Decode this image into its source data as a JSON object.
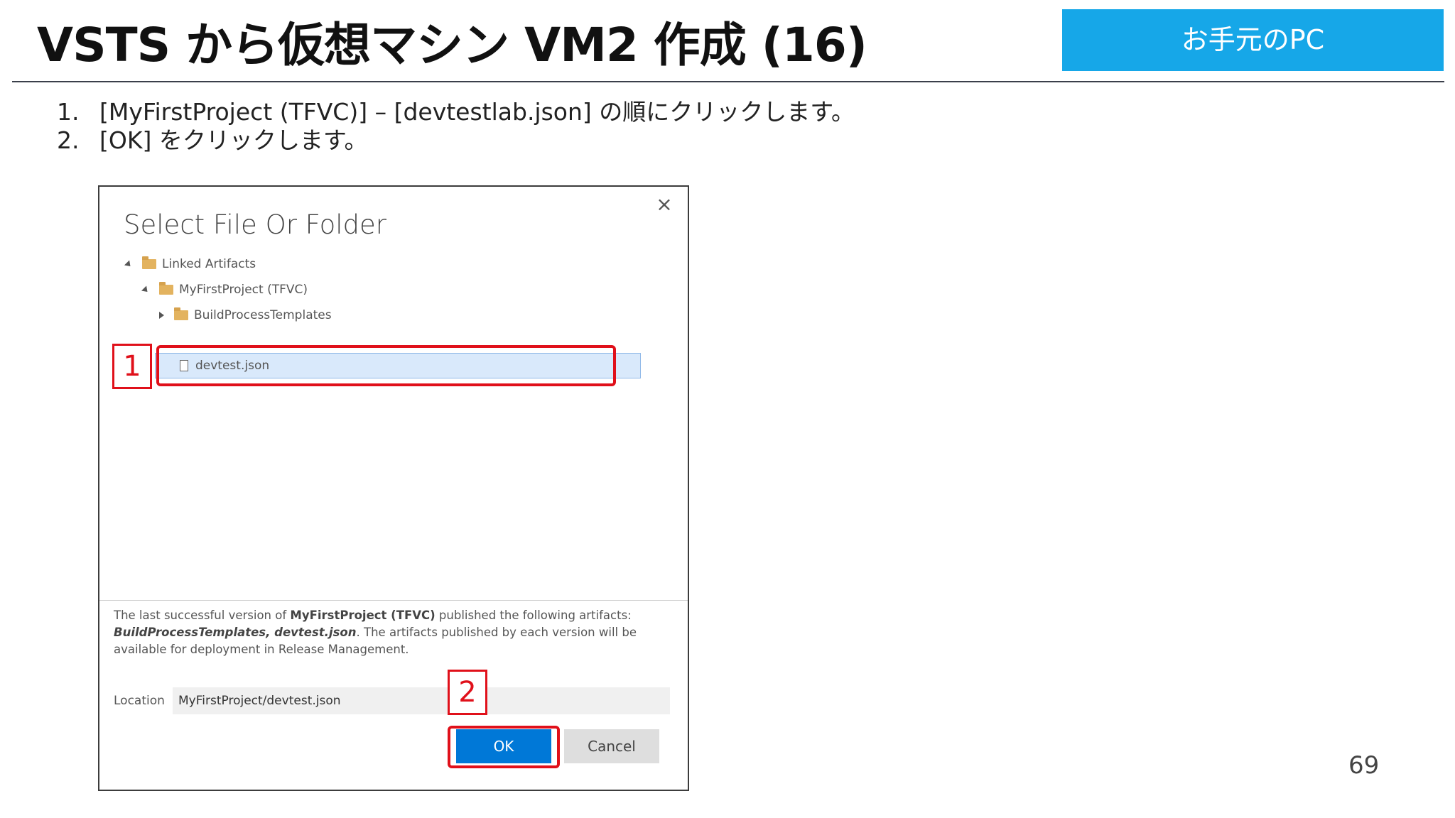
{
  "slide": {
    "title": "VSTS から仮想マシン VM2 作成 (16)",
    "badge": "お手元のPC",
    "page_number": "69",
    "steps": [
      {
        "num": "1.",
        "text": "[MyFirstProject (TFVC)] – [devtestlab.json] の順にクリックします。"
      },
      {
        "num": "2.",
        "text": "[OK] をクリックします。"
      }
    ],
    "markers": [
      "1",
      "2"
    ]
  },
  "dialog": {
    "title": "Select File Or Folder",
    "close_icon": "×",
    "tree": [
      {
        "label": "Linked Artifacts",
        "icon": "folder-icon",
        "expanded": true
      },
      {
        "label": "MyFirstProject (TFVC)",
        "icon": "folder-icon",
        "expanded": true
      },
      {
        "label": "BuildProcessTemplates",
        "icon": "folder-icon",
        "expanded": false
      },
      {
        "label": "devtest.json",
        "icon": "file-icon",
        "selected": true
      }
    ],
    "info": {
      "prefix": "The last successful version of ",
      "project": "MyFirstProject (TFVC)",
      "middle": " published the following artifacts: ",
      "artifacts": "BuildProcessTemplates, devtest.json",
      "suffix": ". The artifacts published by each version will be available for deployment in Release Management."
    },
    "location_label": "Location",
    "location_value": "MyFirstProject/devtest.json",
    "ok_label": "OK",
    "cancel_label": "Cancel"
  },
  "colors": {
    "accent": "#0078d7",
    "badge": "#16a7e8",
    "highlight": "#e0101a",
    "selection": "#d9e9fb"
  }
}
